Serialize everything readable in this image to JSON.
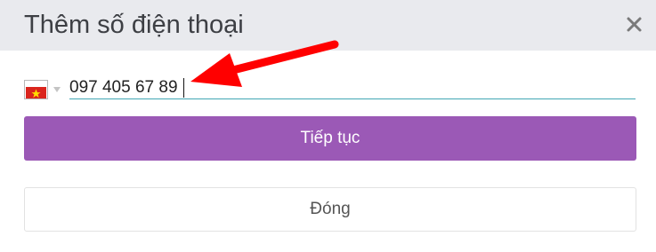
{
  "dialog": {
    "title": "Thêm số điện thoại",
    "close_icon": "close-icon"
  },
  "phone": {
    "country_flag": "vietnam-flag-icon",
    "dropdown_icon": "chevron-down-icon",
    "value": "097 405 67 89"
  },
  "buttons": {
    "continue_label": "Tiếp tục",
    "close_label": "Đóng"
  },
  "colors": {
    "header_bg": "#e9eaee",
    "primary": "#9b59b6",
    "input_underline": "#41a6b4",
    "flag_red": "#da251d",
    "flag_star": "#ffde00",
    "annotation_arrow": "#ff0000"
  },
  "annotation": {
    "icon": "red-arrow-icon"
  }
}
